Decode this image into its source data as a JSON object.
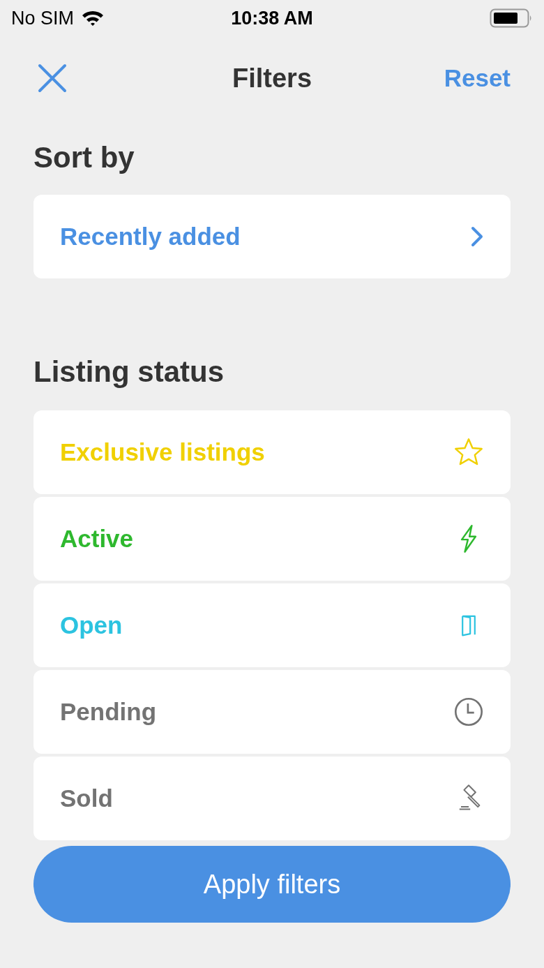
{
  "status_bar": {
    "carrier": "No SIM",
    "time": "10:38 AM"
  },
  "header": {
    "title": "Filters",
    "reset": "Reset"
  },
  "sort": {
    "heading": "Sort by",
    "value": "Recently added"
  },
  "listing_status": {
    "heading": "Listing status",
    "items": [
      {
        "label": "Exclusive listings",
        "kind": "star",
        "color": "#f0d000"
      },
      {
        "label": "Active",
        "kind": "bolt",
        "color": "#2eb82e"
      },
      {
        "label": "Open",
        "kind": "door",
        "color": "#2cc3e0"
      },
      {
        "label": "Pending",
        "kind": "clock",
        "color": "#737373"
      },
      {
        "label": "Sold",
        "kind": "gavel",
        "color": "#737373"
      }
    ]
  },
  "apply_button": "Apply filters"
}
